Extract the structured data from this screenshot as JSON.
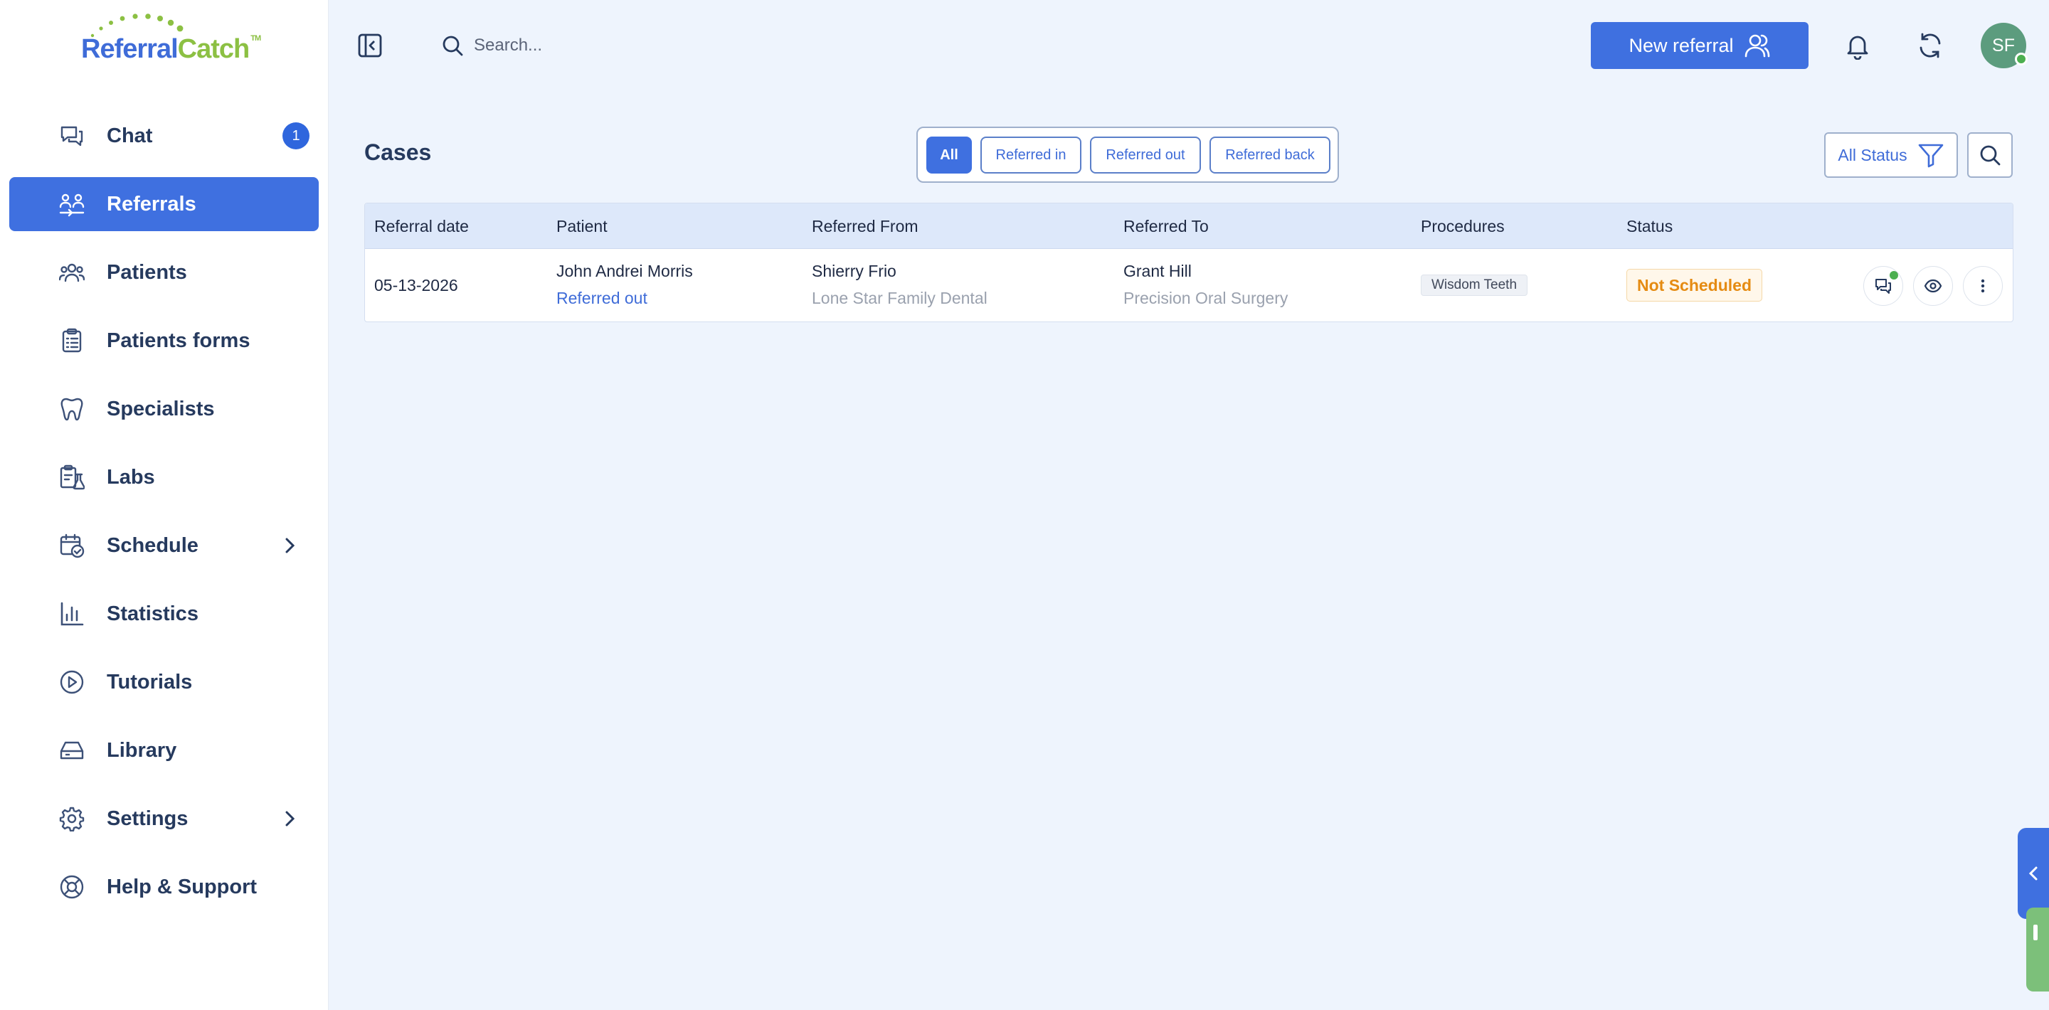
{
  "brand": {
    "name_part1": "Referral",
    "name_part2": "Catch",
    "tm": "TM"
  },
  "sidebar": {
    "items": [
      {
        "label": "Chat",
        "badge": "1"
      },
      {
        "label": "Referrals"
      },
      {
        "label": "Patients"
      },
      {
        "label": "Patients forms"
      },
      {
        "label": "Specialists"
      },
      {
        "label": "Labs"
      },
      {
        "label": "Schedule"
      },
      {
        "label": "Statistics"
      },
      {
        "label": "Tutorials"
      },
      {
        "label": "Library"
      },
      {
        "label": "Settings"
      },
      {
        "label": "Help & Support"
      }
    ]
  },
  "topbar": {
    "search_placeholder": "Search...",
    "new_referral_label": "New referral",
    "avatar_initials": "SF"
  },
  "cases": {
    "title": "Cases",
    "filters": [
      "All",
      "Referred in",
      "Referred out",
      "Referred back"
    ],
    "status_filter_label": "All Status"
  },
  "table": {
    "headers": [
      "Referral date",
      "Patient",
      "Referred From",
      "Referred To",
      "Procedures",
      "Status"
    ],
    "rows": [
      {
        "date": "05-13-2026",
        "patient": "John Andrei Morris",
        "patient_type": "Referred out",
        "from_name": "Shierry Frio",
        "from_practice": "Lone Star Family Dental",
        "to_name": "Grant Hill",
        "to_practice": "Precision Oral Surgery",
        "procedure": "Wisdom Teeth",
        "status": "Not Scheduled"
      }
    ]
  },
  "colors": {
    "primary": "#3f70e0",
    "brand_green": "#8cc043",
    "status_warning": "#e58b12"
  }
}
